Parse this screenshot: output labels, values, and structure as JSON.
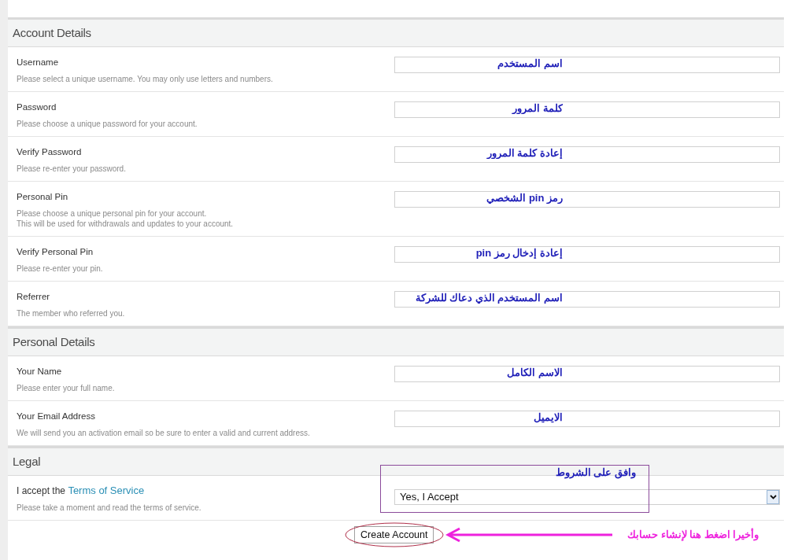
{
  "sections": [
    {
      "title": "Account Details",
      "rows": [
        {
          "kind": "field",
          "label": "Username",
          "description": [
            "Please select a unique username. You may only use letters and numbers."
          ],
          "annotation": "اسم المستخدم"
        },
        {
          "kind": "field",
          "label": "Password",
          "description": [
            "Please choose a unique password for your account."
          ],
          "annotation": "كلمة المرور"
        },
        {
          "kind": "field",
          "label": "Verify Password",
          "description": [
            "Please re-enter your password."
          ],
          "annotation": "إعادة كلمة المرور"
        },
        {
          "kind": "field",
          "label": "Personal Pin",
          "description": [
            "Please choose a unique personal pin for your account.",
            "This will be used for withdrawals and updates to your account."
          ],
          "annotation": "رمز pin الشخصي"
        },
        {
          "kind": "field",
          "label": "Verify Personal Pin",
          "description": [
            "Please re-enter your pin."
          ],
          "annotation": "إعادة إدخال رمز pin"
        },
        {
          "kind": "field",
          "label": "Referrer",
          "description": [
            "The member who referred you."
          ],
          "annotation": "اسم المستخدم الذي دعاك للشركة"
        }
      ]
    },
    {
      "title": "Personal Details",
      "rows": [
        {
          "kind": "field",
          "label": "Your Name",
          "description": [
            "Please enter your full name."
          ],
          "annotation": "الاسم الكامل"
        },
        {
          "kind": "field",
          "label": "Your Email Address",
          "description": [
            "We will send you an activation email so be sure to enter a valid and current address."
          ],
          "annotation": "الايميل"
        }
      ]
    },
    {
      "title": "Legal",
      "rows": [
        {
          "kind": "select",
          "label": "I accept the",
          "link": "Terms of Service",
          "description": [
            "Please take a moment and read the terms of service."
          ],
          "value": "Yes, I Accept",
          "annotation": "وافق على الشروط"
        }
      ]
    }
  ],
  "submit": {
    "label": "Create Account",
    "annotation": "وأخيرا اضغط هنا لإنشاء حسابك"
  }
}
